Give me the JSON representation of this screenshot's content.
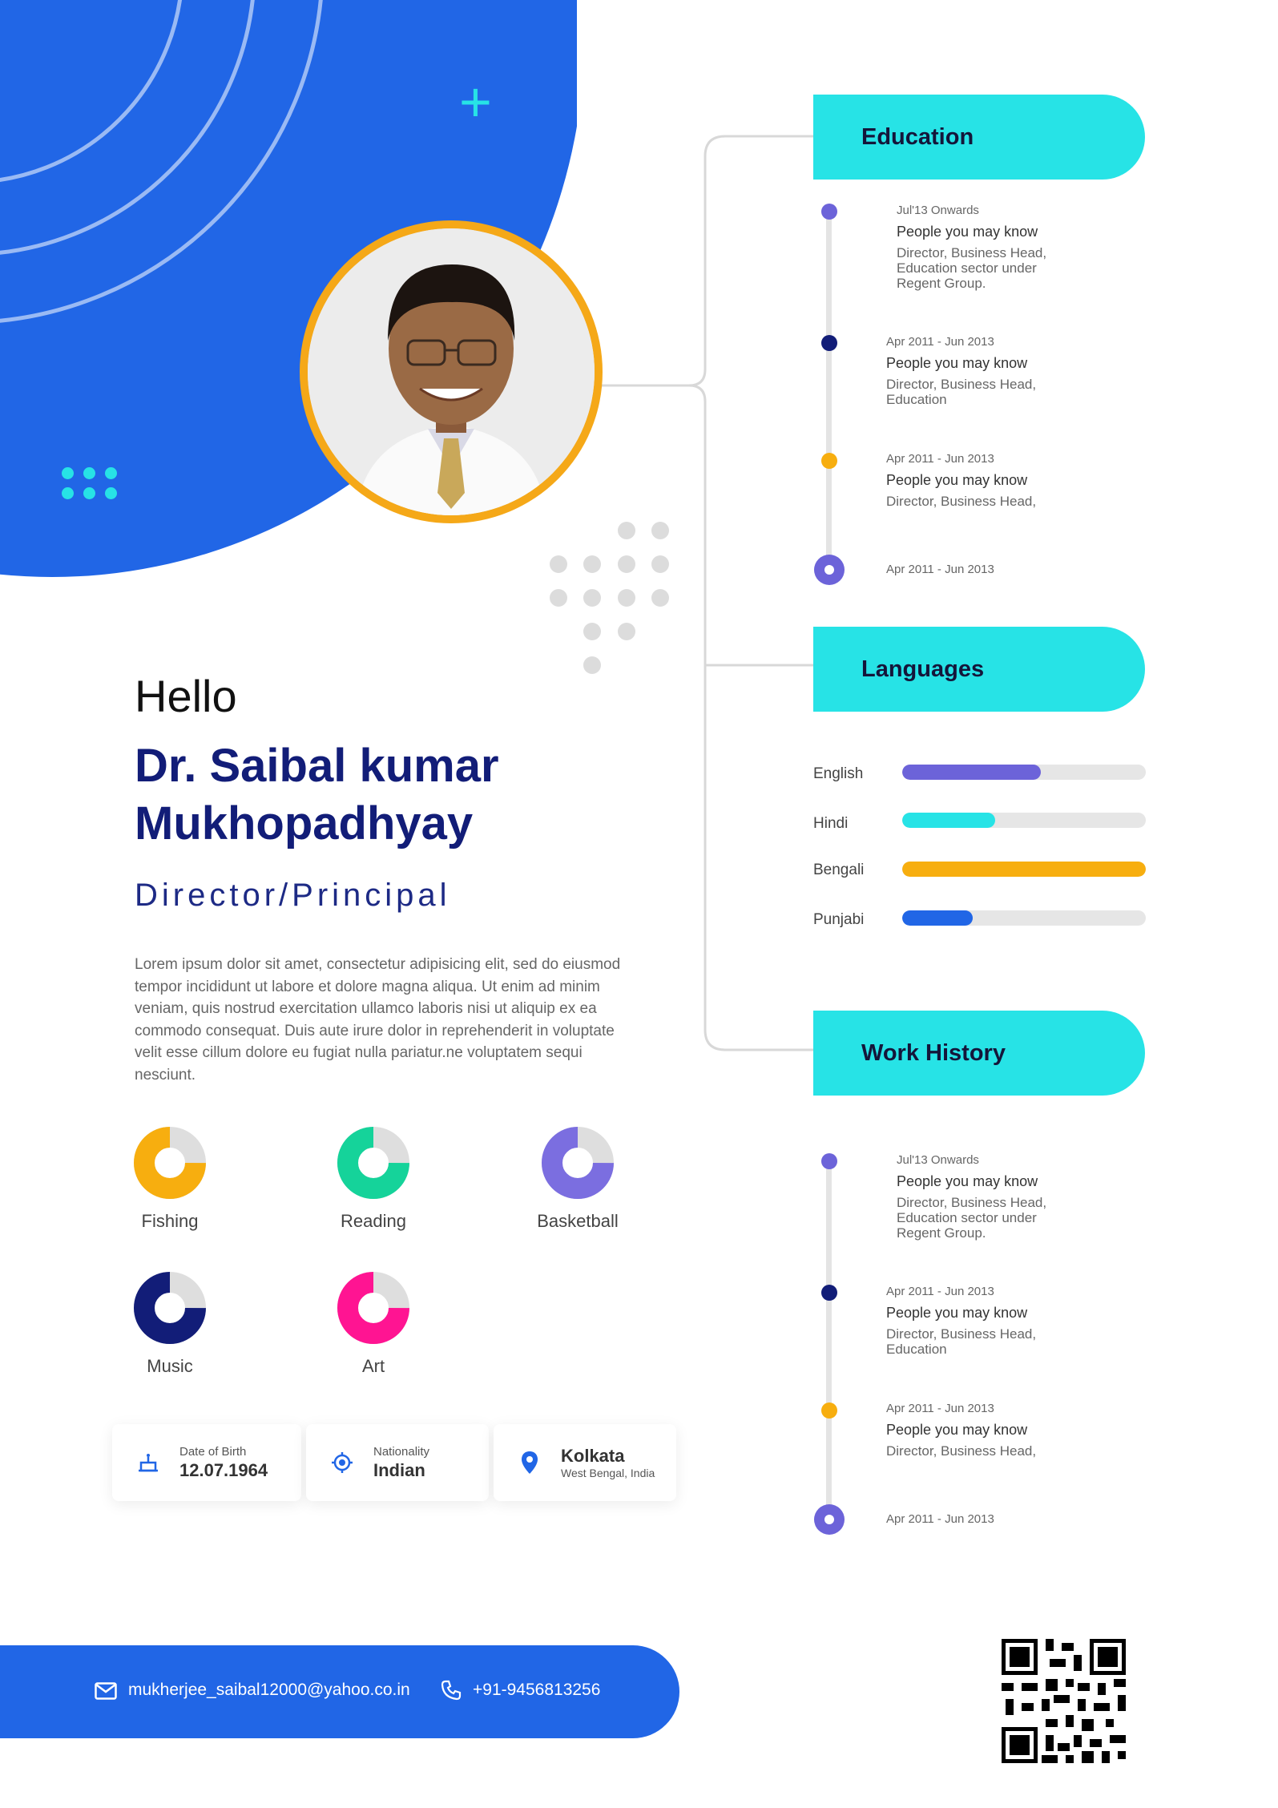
{
  "profile": {
    "greeting": "Hello",
    "name": "Dr. Saibal kumar Mukhopadhyay",
    "role": "Director/Principal",
    "bio": "Lorem ipsum dolor sit amet, consectetur adipisicing elit, sed do eiusmod tempor incididunt ut labore et dolore magna aliqua. Ut enim ad minim veniam, quis nostrud exercitation ullamco laboris nisi ut aliquip ex ea commodo consequat. Duis aute irure dolor in reprehenderit in voluptate velit esse cillum dolore eu fugiat nulla pariatur.ne voluptatem sequi nesciunt."
  },
  "hobbies": [
    {
      "label": "Fishing",
      "value": 0.75,
      "color": "#f7ae0f"
    },
    {
      "label": "Reading",
      "value": 0.75,
      "color": "#15d39a"
    },
    {
      "label": "Basketball",
      "value": 0.75,
      "color": "#7b6ee0"
    },
    {
      "label": "Music",
      "value": 0.75,
      "color": "#121d78"
    },
    {
      "label": "Art",
      "value": 0.75,
      "color": "#ff1492"
    }
  ],
  "info": {
    "dob_label": "Date of Birth",
    "dob_value": "12.07.1964",
    "nationality_label": "Nationality",
    "nationality_value": "Indian",
    "city": "Kolkata",
    "region": "West Bengal, India"
  },
  "contact": {
    "email": "mukherjee_saibal12000@yahoo.co.in",
    "phone": "+91-9456813256"
  },
  "education": {
    "title": "Education",
    "items": [
      {
        "date": "Jul'13 Onwards",
        "title": "People you may know",
        "desc": "Director, Business Head, Education sector under Regent Group.",
        "color": "#6c63d9"
      },
      {
        "date": "Apr 2011 - Jun 2013",
        "title": "People you may know",
        "desc": "Director, Business Head, Education",
        "color": "#121d78"
      },
      {
        "date": "Apr 2011 - Jun 2013",
        "title": "People you may know",
        "desc": "Director, Business Head,",
        "color": "#f7ae0f"
      },
      {
        "date": "Apr 2011 - Jun 2013"
      }
    ]
  },
  "languages": {
    "title": "Languages",
    "items": [
      {
        "label": "English",
        "level": 0.57,
        "color": "#6c63d9"
      },
      {
        "label": "Hindi",
        "level": 0.38,
        "color": "#27e3e6"
      },
      {
        "label": "Bengali",
        "level": 1.0,
        "color": "#f7ae0f"
      },
      {
        "label": "Punjabi",
        "level": 0.29,
        "color": "#2166e6"
      }
    ]
  },
  "work": {
    "title": "Work History",
    "items": [
      {
        "date": "Jul'13 Onwards",
        "title": "People you may know",
        "desc": "Director, Business Head, Education sector under Regent Group.",
        "color": "#6c63d9"
      },
      {
        "date": "Apr 2011 - Jun 2013",
        "title": "People you may know",
        "desc": "Director, Business Head, Education",
        "color": "#121d78"
      },
      {
        "date": "Apr 2011 - Jun 2013",
        "title": "People you may know",
        "desc": "Director, Business Head,",
        "color": "#f7ae0f"
      },
      {
        "date": "Apr 2011 - Jun 2013"
      }
    ]
  },
  "colors": {
    "primary_blue": "#2166e6",
    "cyan": "#27e3e6",
    "navy": "#121d78",
    "orange": "#f5a818"
  }
}
